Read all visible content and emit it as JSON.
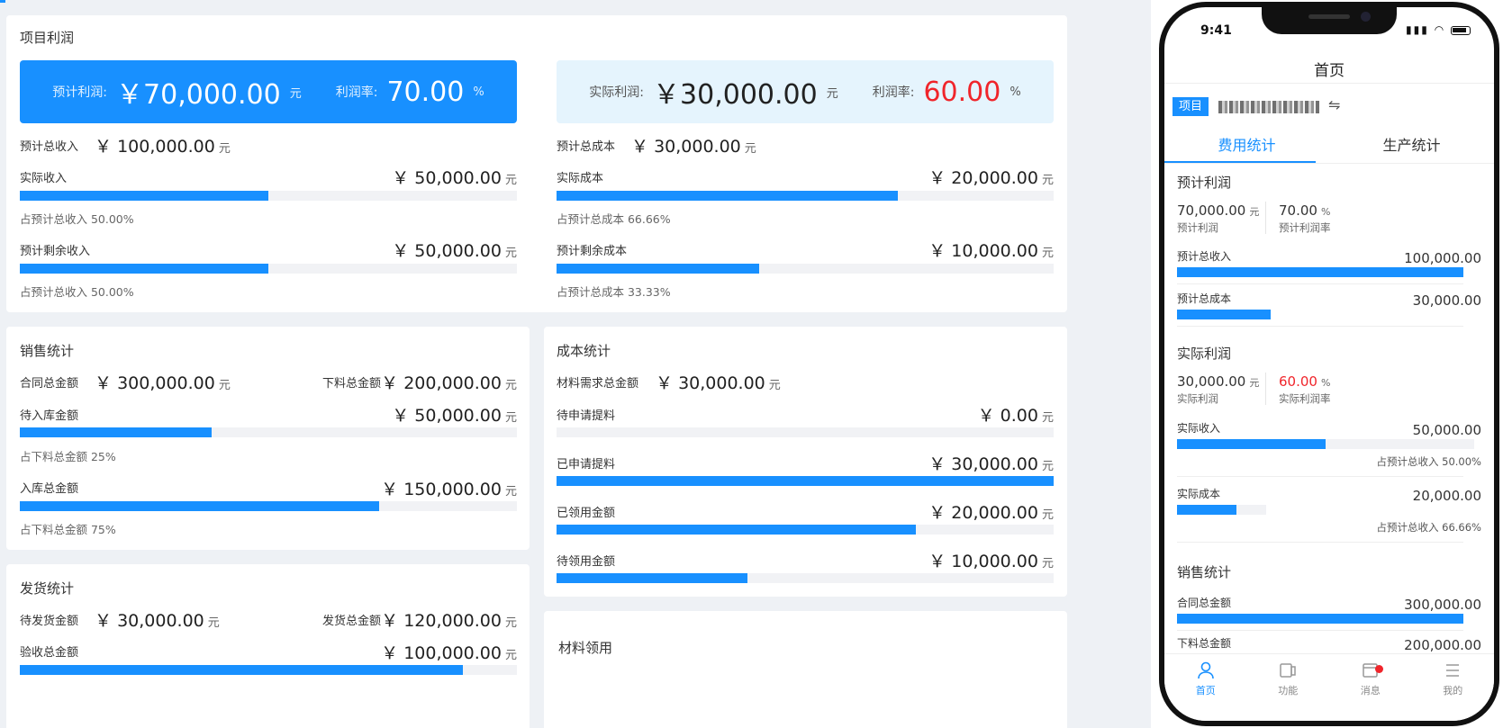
{
  "colors": {
    "accent": "#1890ff",
    "red": "#f0252b",
    "light_blue_bg": "#e5f4fd",
    "page_bg": "#eef1f5",
    "track": "#f1f2f5"
  },
  "currency": "￥",
  "unit": "元",
  "profit": {
    "title": "项目利润",
    "expected": {
      "label": "预计利润:",
      "value": "70,000.00",
      "unit": "元",
      "rate_label": "利润率:",
      "rate": "70.00",
      "rate_unit": "%"
    },
    "actual": {
      "label": "实际利润:",
      "value": "30,000.00",
      "unit": "元",
      "rate_label": "利润率:",
      "rate": "60.00",
      "rate_unit": "%"
    },
    "income": {
      "total_label": "预计总收入",
      "total_value": "100,000.00",
      "rows": [
        {
          "label": "实际收入",
          "value": "50,000.00",
          "fraction": 0.5,
          "note": "占预计总收入 50.00%"
        },
        {
          "label": "预计剩余收入",
          "value": "50,000.00",
          "fraction": 0.5,
          "note": "占预计总收入 50.00%"
        }
      ]
    },
    "cost": {
      "total_label": "预计总成本",
      "total_value": "30,000.00",
      "rows": [
        {
          "label": "实际成本",
          "value": "20,000.00",
          "fraction": 0.6866,
          "note": "占预计总成本 66.66%"
        },
        {
          "label": "预计剩余成本",
          "value": "10,000.00",
          "fraction": 0.4083,
          "note": "占预计总成本 33.33%"
        }
      ]
    }
  },
  "sales": {
    "title": "销售统计",
    "contract_label": "合同总金额",
    "contract_value": "300,000.00",
    "blanking_label": "下料总金额",
    "blanking_value": "200,000.00",
    "rows": [
      {
        "label": "待入库金额",
        "value": "50,000.00",
        "fraction": 0.3853,
        "note": "占下料总金额 25%"
      },
      {
        "label": "入库总金额",
        "value": "150,000.00",
        "fraction": 0.7224,
        "note": "占下料总金额 75%"
      }
    ]
  },
  "cost_stats": {
    "title": "成本统计",
    "material_label": "材料需求总金额",
    "material_value": "30,000.00",
    "rows": [
      {
        "label": "待申请提料",
        "value": "0.00",
        "fraction": 0.0
      },
      {
        "label": "已申请提料",
        "value": "30,000.00",
        "fraction": 1.0
      },
      {
        "label": "已领用金额",
        "value": "20,000.00",
        "fraction": 0.7233
      },
      {
        "label": "待领用金额",
        "value": "10,000.00",
        "fraction": 0.3848
      }
    ]
  },
  "shipping": {
    "title": "发货统计",
    "pending_label": "待发货金额",
    "pending_value": "30,000.00",
    "shipped_label": "发货总金额",
    "shipped_value": "120,000.00",
    "rows": [
      {
        "label": "验收总金额",
        "value": "100,000.00",
        "fraction": 0.8915
      }
    ]
  },
  "material_use": {
    "title": "材料领用"
  },
  "mobile": {
    "status_time": "9:41",
    "title": "首页",
    "project_tag": "项目",
    "tabs": [
      {
        "label": "费用统计"
      },
      {
        "label": "生产统计"
      }
    ],
    "expected_section": {
      "title": "预计利润",
      "kv": [
        {
          "value": "70,000.00",
          "unit": "元",
          "label": "预计利润"
        },
        {
          "value": "70.00",
          "unit": "%",
          "label": "预计利润率"
        }
      ],
      "rows": [
        {
          "label": "预计总收入",
          "value": "100,000.00",
          "fraction": 1.0
        },
        {
          "label": "预计总成本",
          "value": "30,000.00",
          "fraction": 0.3
        }
      ]
    },
    "actual_section": {
      "title": "实际利润",
      "kv": [
        {
          "value": "30,000.00",
          "unit": "元",
          "label": "实际利润"
        },
        {
          "value": "60.00",
          "unit": "%",
          "label": "实际利润率"
        }
      ],
      "rows": [
        {
          "label": "实际收入",
          "value": "50,000.00",
          "fraction": 0.5,
          "note": "占预计总收入 50.00%"
        },
        {
          "label": "实际成本",
          "value": "20,000.00",
          "fraction": 0.6666,
          "note": "占预计总收入 66.66%"
        }
      ]
    },
    "sales_section": {
      "title": "销售统计",
      "rows": [
        {
          "label": "合同总金额",
          "value": "300,000.00",
          "fraction": 1.0
        },
        {
          "label": "下料总金额",
          "value": "200,000.00"
        }
      ]
    },
    "tabbar": [
      {
        "label": "首页",
        "icon": "user-icon"
      },
      {
        "label": "功能",
        "icon": "function-icon"
      },
      {
        "label": "消息",
        "icon": "message-icon"
      },
      {
        "label": "我的",
        "icon": "list-icon"
      }
    ]
  }
}
